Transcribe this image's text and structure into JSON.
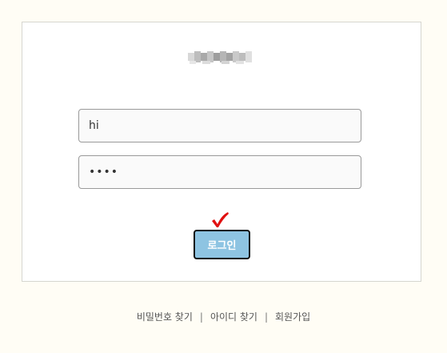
{
  "login_form": {
    "username_value": "hi",
    "password_value": "••••",
    "login_button_label": "로그인"
  },
  "footer": {
    "find_password": "비밀번호 찾기",
    "find_id": "아이디 찾기",
    "signup": "회원가입",
    "separator": "|"
  },
  "colors": {
    "page_background": "#fffdf5",
    "button_fill": "#8ec4e2",
    "check_mark": "#e01010"
  },
  "icons": {
    "check_mark": "check-mark-icon",
    "logo": "blurred-logo"
  }
}
